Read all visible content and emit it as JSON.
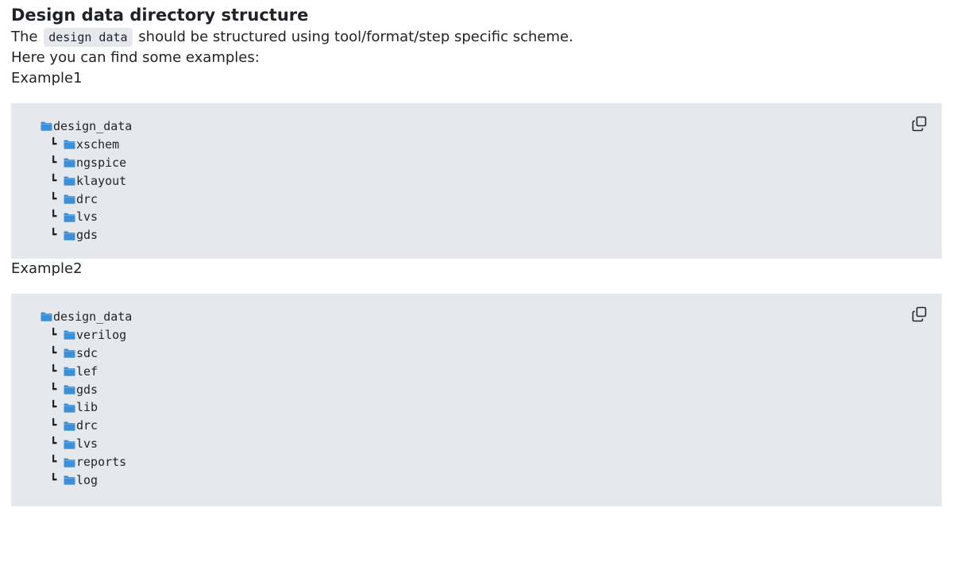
{
  "section": {
    "title": "Design data directory structure"
  },
  "intro": {
    "before": "The",
    "code": "design data",
    "after": "should be structured using tool/format/step specific scheme."
  },
  "examples_intro": "Here you can find some examples:",
  "examples": [
    {
      "label": "Example1",
      "root": "design_data",
      "children": [
        "xschem",
        "ngspice",
        "klayout",
        "drc",
        "lvs",
        "gds"
      ]
    },
    {
      "label": "Example2",
      "root": "design_data",
      "children": [
        "verilog",
        "sdc",
        "lef",
        "gds",
        "lib",
        "drc",
        "lvs",
        "reports",
        "log"
      ]
    }
  ],
  "icons": {
    "folder": "folder-icon",
    "branch": "┗",
    "copy": "copy-icon"
  },
  "colors": {
    "code_bg": "#e5e8ed",
    "folder_blue": "#3d8fd8",
    "text": "#1f2328"
  }
}
